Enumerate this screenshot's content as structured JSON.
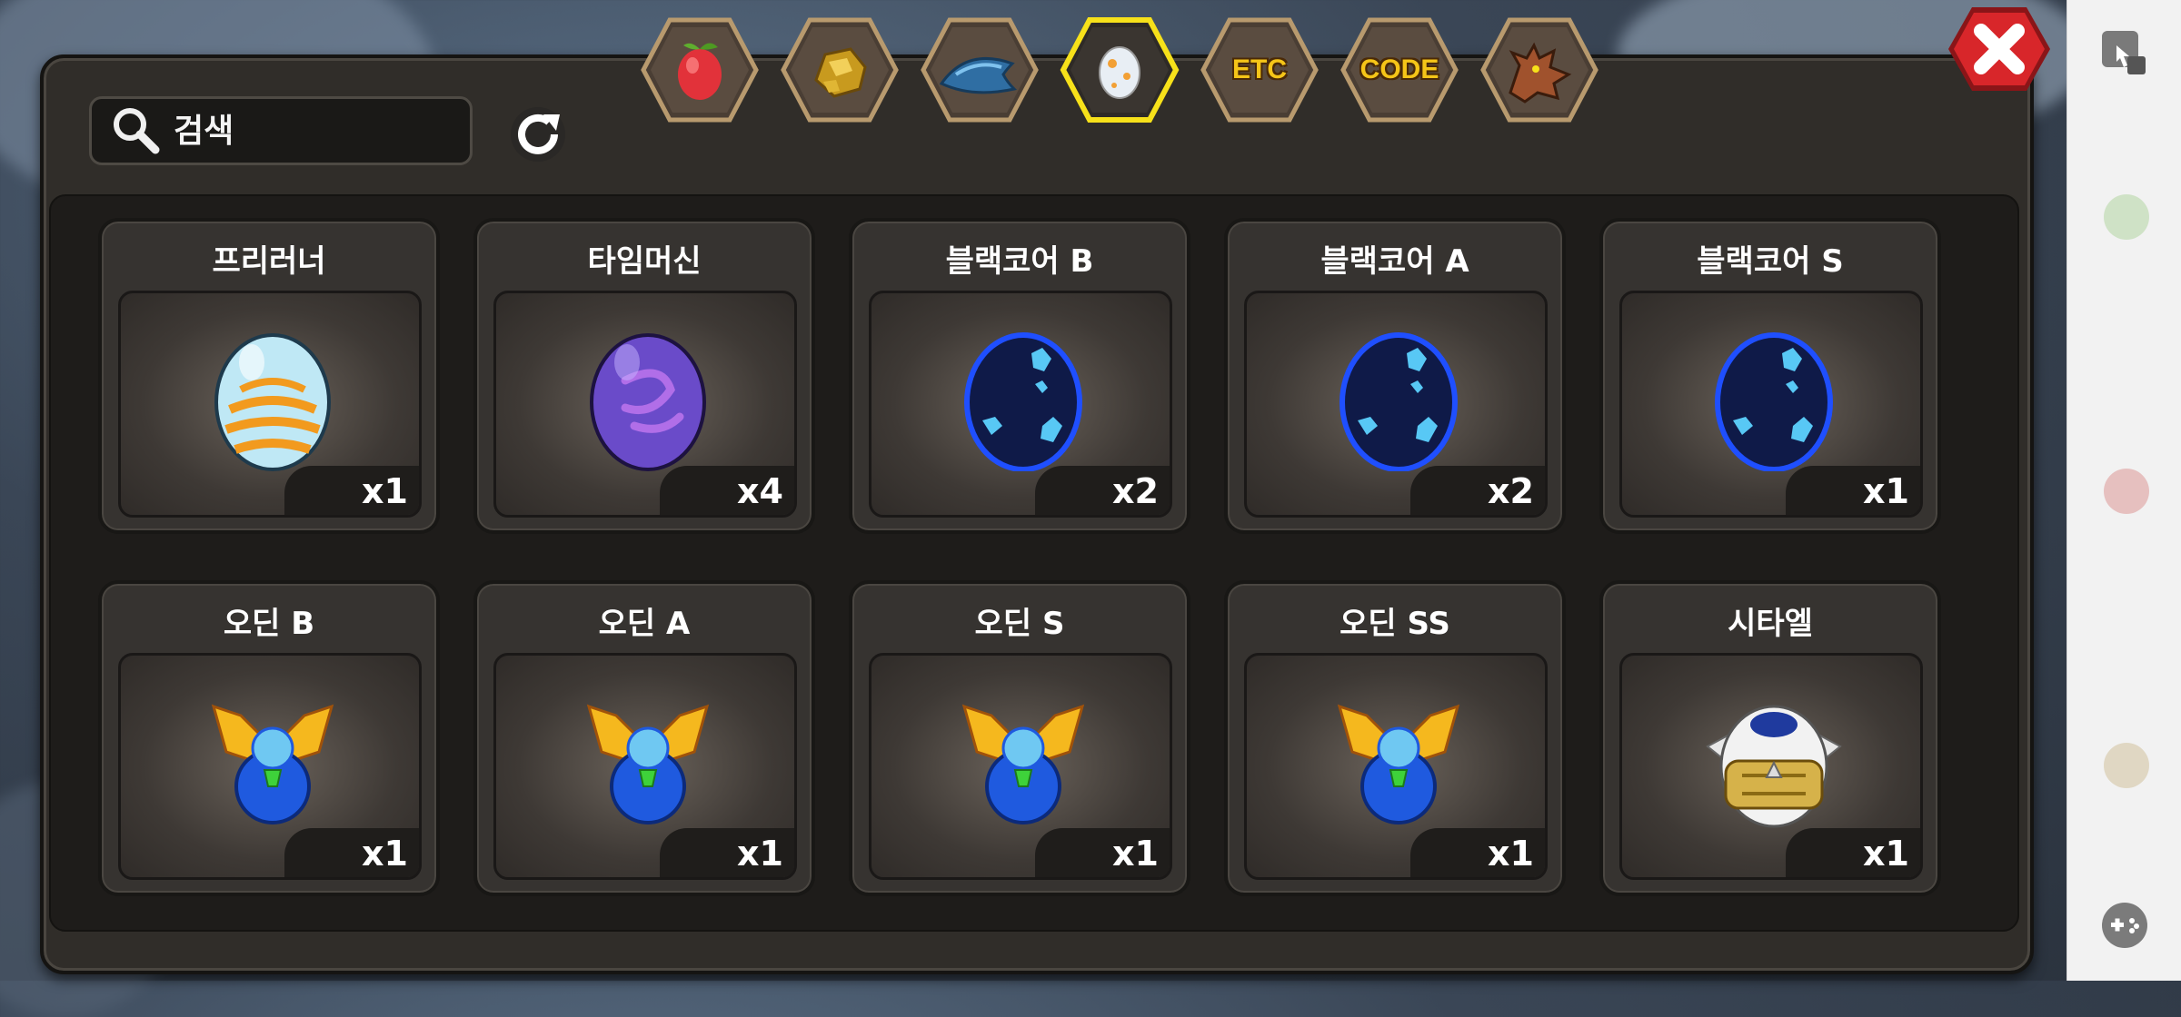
{
  "search": {
    "placeholder": "검색"
  },
  "tabs": [
    {
      "id": "fruit",
      "icon": "red-fruit-icon",
      "label": ""
    },
    {
      "id": "ore",
      "icon": "gold-ore-icon",
      "label": ""
    },
    {
      "id": "fish",
      "icon": "blue-fish-icon",
      "label": ""
    },
    {
      "id": "egg",
      "icon": "egg-icon",
      "label": "",
      "active": true
    },
    {
      "id": "etc",
      "icon": "",
      "label": "ETC"
    },
    {
      "id": "code",
      "icon": "",
      "label": "CODE"
    },
    {
      "id": "dragon",
      "icon": "dragon-head-icon",
      "label": ""
    }
  ],
  "items": [
    {
      "name": "프리러너",
      "qty": "x1",
      "icon": "freerunner-egg-icon"
    },
    {
      "name": "타임머신",
      "qty": "x4",
      "icon": "timemachine-egg-icon"
    },
    {
      "name": "블랙코어 B",
      "qty": "x2",
      "icon": "blackcore-egg-icon"
    },
    {
      "name": "블랙코어 A",
      "qty": "x2",
      "icon": "blackcore-egg-icon"
    },
    {
      "name": "블랙코어 S",
      "qty": "x1",
      "icon": "blackcore-egg-icon"
    },
    {
      "name": "오딘 B",
      "qty": "x1",
      "icon": "odin-emblem-icon"
    },
    {
      "name": "오딘 A",
      "qty": "x1",
      "icon": "odin-emblem-icon"
    },
    {
      "name": "오딘 S",
      "qty": "x1",
      "icon": "odin-emblem-icon"
    },
    {
      "name": "오딘 SS",
      "qty": "x1",
      "icon": "odin-emblem-icon"
    },
    {
      "name": "시타엘",
      "qty": "x1",
      "icon": "citael-egg-icon"
    }
  ],
  "colors": {
    "tab_active_border": "#f7e11a",
    "tab_label": "#f5c518",
    "close_red": "#d8262a"
  },
  "side_strip": {
    "icons": [
      "touch-icon",
      "green-dot",
      "red-dot",
      "beige-dot",
      "gamepad-icon"
    ]
  }
}
